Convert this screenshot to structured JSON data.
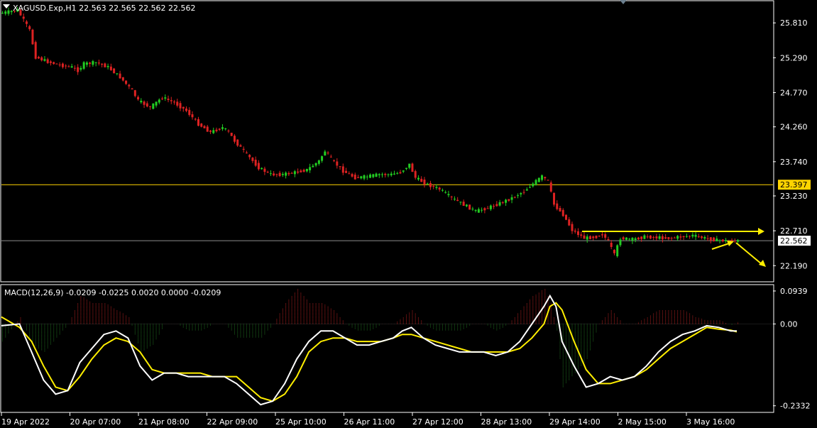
{
  "header": {
    "title": "XAGUSD.Exp,H1  22.563 22.565 22.562 22.562",
    "macd_label": "MACD(12,26,9) -0.0209 -0.0225 0.0020 0.0000 -0.0209"
  },
  "price_axis": {
    "ticks": [
      "25.810",
      "25.290",
      "24.770",
      "24.260",
      "23.740",
      "23.230",
      "22.710",
      "22.190"
    ],
    "tick_values": [
      25.81,
      25.29,
      24.77,
      24.26,
      23.74,
      23.23,
      22.71,
      22.19
    ],
    "range": [
      21.96,
      26.13
    ]
  },
  "price_lines": {
    "support_label": "23.397",
    "support_value": 23.397,
    "support_color": "#ffd400",
    "bid_label": "22.562",
    "bid_value": 22.562,
    "bid_color": "#8c8c8c"
  },
  "macd_axis": {
    "ticks": [
      "0.0939",
      "0.00",
      "-0.2332"
    ],
    "tick_values": [
      0.0939,
      0.0,
      -0.2332
    ],
    "range": [
      -0.25,
      0.11
    ]
  },
  "time_axis": {
    "labels": [
      "19 Apr 2022",
      "20 Apr 07:00",
      "21 Apr 08:00",
      "22 Apr 09:00",
      "25 Apr 10:00",
      "26 Apr 11:00",
      "27 Apr 12:00",
      "28 Apr 13:00",
      "29 Apr 14:00",
      "2 May 15:00",
      "3 May 16:00"
    ]
  },
  "colors": {
    "bull": "#22cc22",
    "bear": "#dd2222",
    "macd_main": "#ffffff",
    "macd_signal": "#ffee00",
    "annotation": "#ffee00",
    "axis": "#ffffff"
  },
  "chart_data": {
    "type": "line",
    "symbol": "XAGUSD.Exp",
    "timeframe": "H1",
    "price_path": [
      [
        0,
        25.95
      ],
      [
        6,
        26.0
      ],
      [
        10,
        25.7
      ],
      [
        12,
        25.3
      ],
      [
        16,
        25.23
      ],
      [
        20,
        25.18
      ],
      [
        24,
        25.15
      ],
      [
        26,
        25.1
      ],
      [
        28,
        25.2
      ],
      [
        32,
        25.22
      ],
      [
        36,
        25.15
      ],
      [
        40,
        25.0
      ],
      [
        44,
        24.8
      ],
      [
        46,
        24.65
      ],
      [
        50,
        24.55
      ],
      [
        54,
        24.7
      ],
      [
        58,
        24.62
      ],
      [
        62,
        24.5
      ],
      [
        66,
        24.3
      ],
      [
        70,
        24.18
      ],
      [
        74,
        24.25
      ],
      [
        76,
        24.18
      ],
      [
        78,
        24.05
      ],
      [
        82,
        23.85
      ],
      [
        86,
        23.65
      ],
      [
        90,
        23.55
      ],
      [
        94,
        23.55
      ],
      [
        98,
        23.58
      ],
      [
        102,
        23.62
      ],
      [
        106,
        23.75
      ],
      [
        108,
        23.9
      ],
      [
        110,
        23.78
      ],
      [
        114,
        23.6
      ],
      [
        118,
        23.5
      ],
      [
        122,
        23.52
      ],
      [
        126,
        23.55
      ],
      [
        130,
        23.55
      ],
      [
        133,
        23.58
      ],
      [
        136,
        23.7
      ],
      [
        138,
        23.5
      ],
      [
        142,
        23.4
      ],
      [
        146,
        23.33
      ],
      [
        150,
        23.2
      ],
      [
        154,
        23.1
      ],
      [
        158,
        23.0
      ],
      [
        162,
        23.05
      ],
      [
        166,
        23.12
      ],
      [
        170,
        23.2
      ],
      [
        174,
        23.3
      ],
      [
        178,
        23.45
      ],
      [
        180,
        23.52
      ],
      [
        182,
        23.45
      ],
      [
        184,
        23.1
      ],
      [
        187,
        22.95
      ],
      [
        190,
        22.72
      ],
      [
        194,
        22.6
      ],
      [
        198,
        22.62
      ],
      [
        200,
        22.66
      ],
      [
        202,
        22.55
      ],
      [
        204,
        22.35
      ],
      [
        206,
        22.6
      ],
      [
        210,
        22.58
      ],
      [
        214,
        22.62
      ],
      [
        218,
        22.61
      ],
      [
        222,
        22.6
      ],
      [
        226,
        22.62
      ],
      [
        230,
        22.64
      ],
      [
        234,
        22.6
      ],
      [
        238,
        22.57
      ],
      [
        242,
        22.56
      ],
      [
        244,
        22.56
      ]
    ],
    "macd_main": [
      [
        0,
        -0.005
      ],
      [
        6,
        0.0
      ],
      [
        10,
        -0.08
      ],
      [
        14,
        -0.16
      ],
      [
        18,
        -0.2
      ],
      [
        22,
        -0.19
      ],
      [
        26,
        -0.11
      ],
      [
        30,
        -0.07
      ],
      [
        34,
        -0.03
      ],
      [
        38,
        -0.02
      ],
      [
        42,
        -0.04
      ],
      [
        46,
        -0.12
      ],
      [
        50,
        -0.16
      ],
      [
        54,
        -0.14
      ],
      [
        58,
        -0.14
      ],
      [
        62,
        -0.15
      ],
      [
        66,
        -0.15
      ],
      [
        70,
        -0.15
      ],
      [
        74,
        -0.15
      ],
      [
        78,
        -0.17
      ],
      [
        82,
        -0.2
      ],
      [
        86,
        -0.23
      ],
      [
        90,
        -0.22
      ],
      [
        94,
        -0.17
      ],
      [
        98,
        -0.1
      ],
      [
        102,
        -0.05
      ],
      [
        106,
        -0.02
      ],
      [
        110,
        -0.02
      ],
      [
        114,
        -0.04
      ],
      [
        118,
        -0.06
      ],
      [
        122,
        -0.06
      ],
      [
        126,
        -0.05
      ],
      [
        130,
        -0.04
      ],
      [
        133,
        -0.02
      ],
      [
        136,
        -0.01
      ],
      [
        140,
        -0.04
      ],
      [
        144,
        -0.06
      ],
      [
        148,
        -0.07
      ],
      [
        152,
        -0.08
      ],
      [
        156,
        -0.08
      ],
      [
        160,
        -0.08
      ],
      [
        164,
        -0.09
      ],
      [
        168,
        -0.08
      ],
      [
        172,
        -0.05
      ],
      [
        176,
        0.0
      ],
      [
        180,
        0.05
      ],
      [
        182,
        0.08
      ],
      [
        184,
        0.05
      ],
      [
        186,
        -0.05
      ],
      [
        190,
        -0.12
      ],
      [
        194,
        -0.18
      ],
      [
        198,
        -0.17
      ],
      [
        202,
        -0.15
      ],
      [
        206,
        -0.16
      ],
      [
        210,
        -0.15
      ],
      [
        214,
        -0.12
      ],
      [
        218,
        -0.08
      ],
      [
        222,
        -0.05
      ],
      [
        226,
        -0.03
      ],
      [
        230,
        -0.02
      ],
      [
        234,
        -0.005
      ],
      [
        238,
        -0.01
      ],
      [
        242,
        -0.02
      ],
      [
        244,
        -0.02
      ]
    ],
    "macd_signal": [
      [
        0,
        0.02
      ],
      [
        6,
        -0.01
      ],
      [
        10,
        -0.05
      ],
      [
        14,
        -0.12
      ],
      [
        18,
        -0.18
      ],
      [
        22,
        -0.19
      ],
      [
        26,
        -0.15
      ],
      [
        30,
        -0.1
      ],
      [
        34,
        -0.06
      ],
      [
        38,
        -0.04
      ],
      [
        42,
        -0.05
      ],
      [
        46,
        -0.08
      ],
      [
        50,
        -0.13
      ],
      [
        54,
        -0.14
      ],
      [
        58,
        -0.14
      ],
      [
        62,
        -0.14
      ],
      [
        66,
        -0.14
      ],
      [
        70,
        -0.15
      ],
      [
        74,
        -0.15
      ],
      [
        78,
        -0.15
      ],
      [
        82,
        -0.18
      ],
      [
        86,
        -0.21
      ],
      [
        90,
        -0.22
      ],
      [
        94,
        -0.2
      ],
      [
        98,
        -0.15
      ],
      [
        102,
        -0.08
      ],
      [
        106,
        -0.05
      ],
      [
        110,
        -0.04
      ],
      [
        114,
        -0.04
      ],
      [
        118,
        -0.05
      ],
      [
        122,
        -0.05
      ],
      [
        126,
        -0.05
      ],
      [
        130,
        -0.04
      ],
      [
        133,
        -0.03
      ],
      [
        136,
        -0.03
      ],
      [
        140,
        -0.04
      ],
      [
        144,
        -0.05
      ],
      [
        148,
        -0.06
      ],
      [
        152,
        -0.07
      ],
      [
        156,
        -0.08
      ],
      [
        160,
        -0.08
      ],
      [
        164,
        -0.08
      ],
      [
        168,
        -0.08
      ],
      [
        172,
        -0.07
      ],
      [
        176,
        -0.04
      ],
      [
        180,
        0.0
      ],
      [
        182,
        0.05
      ],
      [
        184,
        0.06
      ],
      [
        186,
        0.04
      ],
      [
        190,
        -0.05
      ],
      [
        194,
        -0.13
      ],
      [
        198,
        -0.17
      ],
      [
        202,
        -0.17
      ],
      [
        206,
        -0.16
      ],
      [
        210,
        -0.15
      ],
      [
        214,
        -0.13
      ],
      [
        218,
        -0.1
      ],
      [
        222,
        -0.07
      ],
      [
        226,
        -0.05
      ],
      [
        230,
        -0.03
      ],
      [
        234,
        -0.01
      ],
      [
        238,
        -0.015
      ],
      [
        242,
        -0.018
      ],
      [
        244,
        -0.0225
      ]
    ],
    "x_range": [
      0,
      256
    ]
  }
}
